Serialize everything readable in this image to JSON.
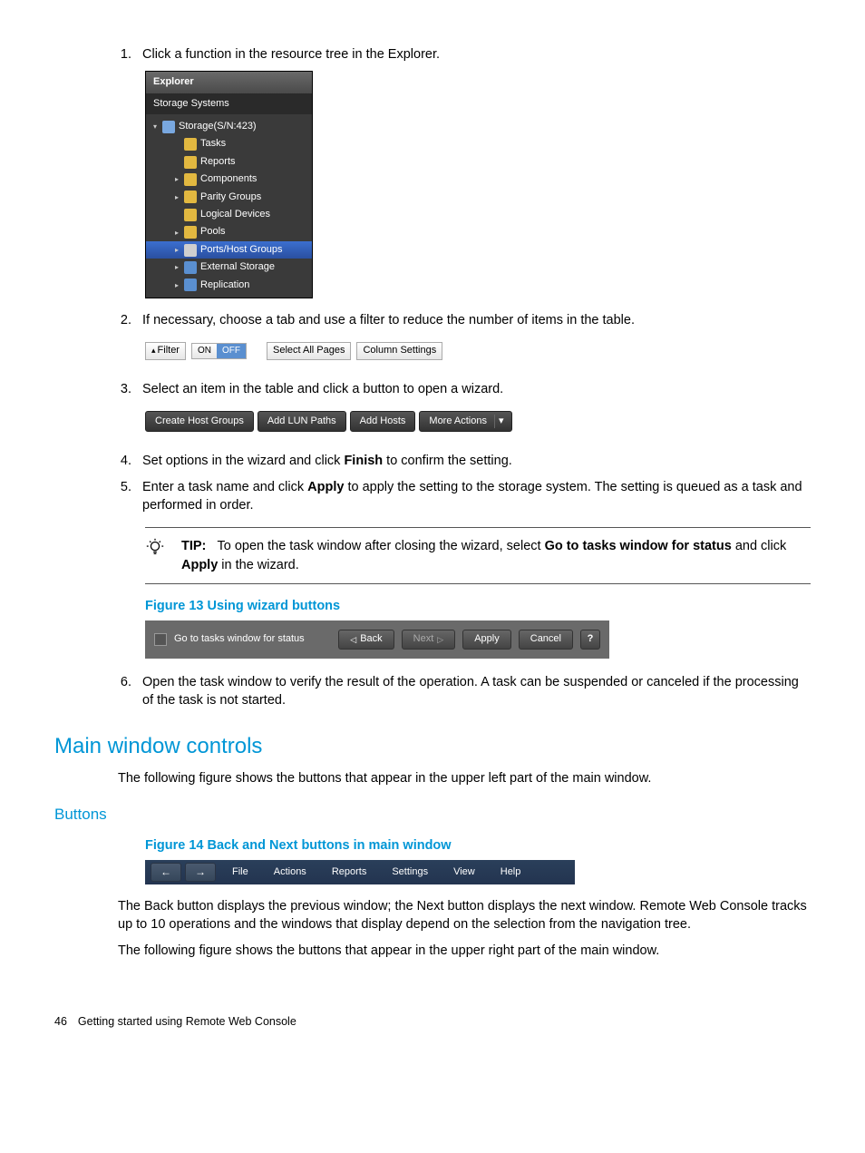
{
  "steps": {
    "s1_num": "1.",
    "s1_text": "Click a function in the resource tree in the Explorer.",
    "s2_num": "2.",
    "s2_text": "If necessary, choose a tab and use a filter to reduce the number of items in the table.",
    "s3_num": "3.",
    "s3_text": "Select an item in the table and click a button to open a wizard.",
    "s4_num": "4.",
    "s4_pre": "Set options in the wizard and click ",
    "s4_bold": "Finish",
    "s4_post": " to confirm the setting.",
    "s5_num": "5.",
    "s5_pre": "Enter a task name and click ",
    "s5_bold": "Apply",
    "s5_post": " to apply the setting to the storage system. The setting is queued as a task and performed in order.",
    "s6_num": "6.",
    "s6_text": "Open the task window to verify the result of the operation. A task can be suspended or canceled if the processing of the task is not started."
  },
  "explorer": {
    "title": "Explorer",
    "subtitle": "Storage Systems",
    "root": "Storage(S/N:423)",
    "items": {
      "tasks": "Tasks",
      "reports": "Reports",
      "components": "Components",
      "parity": "Parity Groups",
      "logical": "Logical Devices",
      "pools": "Pools",
      "ports": "Ports/Host Groups",
      "external": "External Storage",
      "replication": "Replication"
    }
  },
  "filter": {
    "label": "Filter",
    "on": "ON",
    "off": "OFF",
    "select_all": "Select All Pages",
    "col_settings": "Column Settings"
  },
  "actions": {
    "create_host": "Create Host Groups",
    "add_lun": "Add LUN Paths",
    "add_hosts": "Add Hosts",
    "more": "More Actions"
  },
  "tip": {
    "label": "TIP:",
    "pre": "To open the task window after closing the wizard, select ",
    "bold1": "Go to tasks window for status",
    "mid": " and click ",
    "bold2": "Apply",
    "post": " in the wizard."
  },
  "figure13_caption": "Figure 13 Using wizard buttons",
  "wizard": {
    "checkbox_label": "Go to tasks window for status",
    "back": "Back",
    "next": "Next",
    "apply": "Apply",
    "cancel": "Cancel",
    "help": "?"
  },
  "section_h1": "Main window controls",
  "controls_intro": "The following figure shows the buttons that appear in the upper left part of the main window.",
  "section_h2": "Buttons",
  "figure14_caption": "Figure 14 Back and Next buttons in main window",
  "menubar": {
    "back": "←",
    "next": "→",
    "file": "File",
    "actions": "Actions",
    "reports": "Reports",
    "settings": "Settings",
    "view": "View",
    "help": "Help"
  },
  "buttons_p1": "The Back button displays the previous window; the Next button displays the next window. Remote Web Console tracks up to 10 operations and the windows that display depend on the selection from the navigation tree.",
  "buttons_p2": "The following figure shows the buttons that appear in the upper right part of the main window.",
  "footer_page": "46",
  "footer_text": "Getting started using Remote Web Console"
}
